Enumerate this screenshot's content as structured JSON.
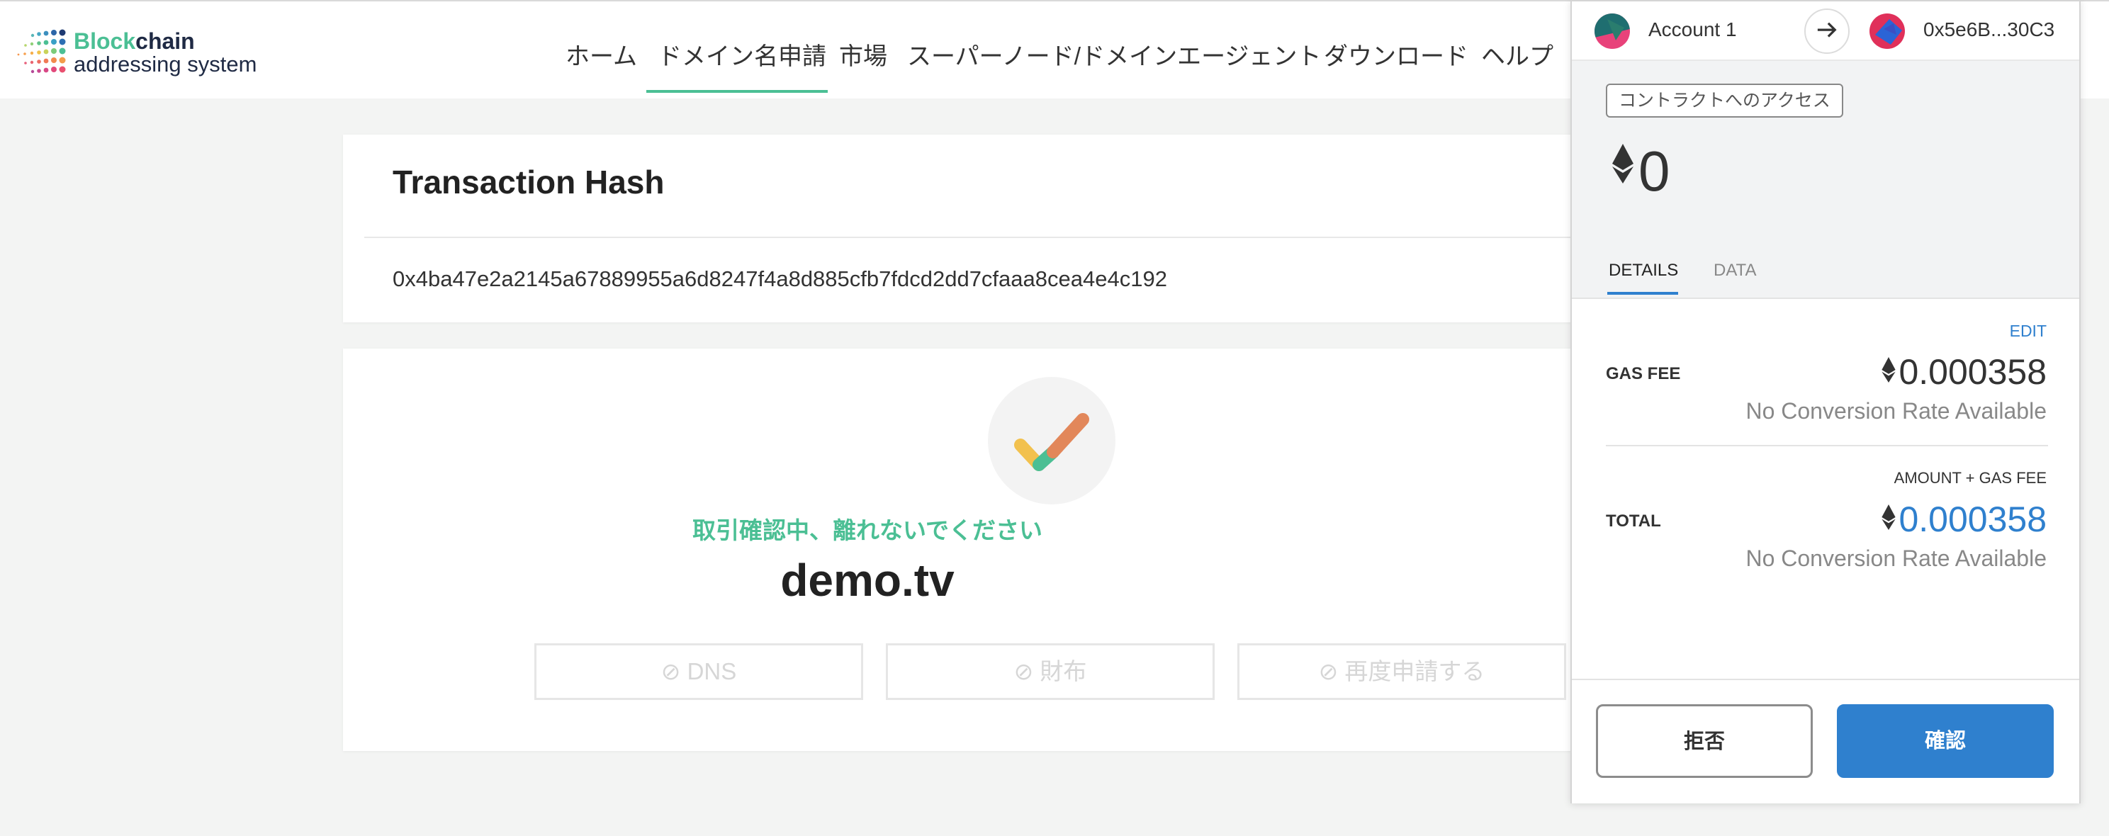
{
  "logo": {
    "line1_part1": "Block",
    "line1_part2": "chain",
    "line2": "addressing system"
  },
  "nav": {
    "items": [
      {
        "label": "ホーム"
      },
      {
        "label": "ドメイン名申請"
      },
      {
        "label": "市場"
      },
      {
        "label": "スーパーノード/ドメインエージェント"
      },
      {
        "label": "ダウンロード"
      },
      {
        "label": "ヘルプ"
      }
    ],
    "active_index": 1
  },
  "transaction": {
    "title": "Transaction Hash",
    "hash": "0x4ba47e2a2145a67889955a6d8247f4a8d885cfb7fdcd2dd7cfaaa8cea4e4c192"
  },
  "status": {
    "message": "取引確認中、離れないでください",
    "domain": "demo.tv",
    "buttons": [
      {
        "label": "⊘ DNS"
      },
      {
        "label": "⊘ 財布"
      },
      {
        "label": "⊘ 再度申請する"
      }
    ]
  },
  "metamask": {
    "account_name": "Account 1",
    "dest_address": "0x5e6B...30C3",
    "badge": "コントラクトへのアクセス",
    "amount": "0",
    "tabs": [
      {
        "label": "DETAILS"
      },
      {
        "label": "DATA"
      }
    ],
    "active_tab": 0,
    "edit_label": "EDIT",
    "gas_fee_label": "GAS FEE",
    "gas_fee_value": "0.000358",
    "no_conversion": "No Conversion Rate Available",
    "amount_gas_label": "AMOUNT + GAS FEE",
    "total_label": "TOTAL",
    "total_value": "0.000358",
    "reject_label": "拒否",
    "confirm_label": "確認",
    "icons": {
      "eth": "ethereum-icon",
      "arrow": "arrow-right-icon"
    }
  },
  "colors": {
    "accent_green": "#4bbf94",
    "metamask_blue": "#2f80ce"
  }
}
